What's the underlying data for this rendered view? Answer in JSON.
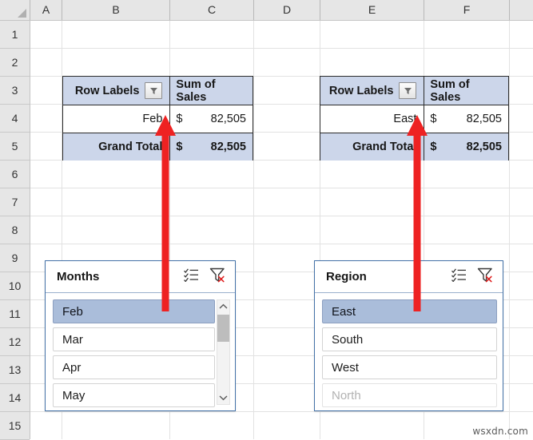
{
  "spreadsheet": {
    "column_headers": [
      "A",
      "B",
      "C",
      "D",
      "E",
      "F"
    ],
    "row_headers": [
      "1",
      "2",
      "3",
      "4",
      "5",
      "6",
      "7",
      "8",
      "9",
      "10",
      "11",
      "12",
      "13",
      "14",
      "15"
    ]
  },
  "pivot_tables": [
    {
      "name": "months-pivot-table",
      "col_headers": [
        "Row Labels",
        "Sum of Sales"
      ],
      "filter_icon": "filter-funnel-icon",
      "rows": [
        {
          "label": "Feb",
          "currency": "$",
          "value": "82,505"
        }
      ],
      "total": {
        "label": "Grand Total",
        "currency": "$",
        "value": "82,505"
      }
    },
    {
      "name": "region-pivot-table",
      "col_headers": [
        "Row Labels",
        "Sum of Sales"
      ],
      "filter_icon": "filter-funnel-icon",
      "rows": [
        {
          "label": "East",
          "currency": "$",
          "value": "82,505"
        }
      ],
      "total": {
        "label": "Grand Total",
        "currency": "$",
        "value": "82,505"
      }
    }
  ],
  "slicers": [
    {
      "name": "months-slicer",
      "title": "Months",
      "multiselect_icon": "multi-select-icon",
      "clear_filter_icon": "clear-filter-icon",
      "has_scrollbar": true,
      "items": [
        {
          "label": "Feb",
          "state": "selected"
        },
        {
          "label": "Mar",
          "state": "normal"
        },
        {
          "label": "Apr",
          "state": "normal"
        },
        {
          "label": "May",
          "state": "normal"
        }
      ]
    },
    {
      "name": "region-slicer",
      "title": "Region",
      "multiselect_icon": "multi-select-icon",
      "clear_filter_icon": "clear-filter-icon",
      "has_scrollbar": false,
      "items": [
        {
          "label": "East",
          "state": "selected"
        },
        {
          "label": "South",
          "state": "normal"
        },
        {
          "label": "West",
          "state": "normal"
        },
        {
          "label": "North",
          "state": "disabled"
        }
      ]
    }
  ],
  "annotations": {
    "arrow_color": "#ee2222",
    "arrows": [
      {
        "name": "months-slicer-to-pivot-arrow"
      },
      {
        "name": "region-slicer-to-pivot-arrow"
      }
    ]
  },
  "watermark": {
    "text": "wsxdn.com"
  },
  "colors": {
    "pivot_header_fill": "#ccd6ea",
    "slicer_border": "#4472a8",
    "slicer_selected_fill": "#aabdda",
    "arrow_red": "#ee2222"
  }
}
